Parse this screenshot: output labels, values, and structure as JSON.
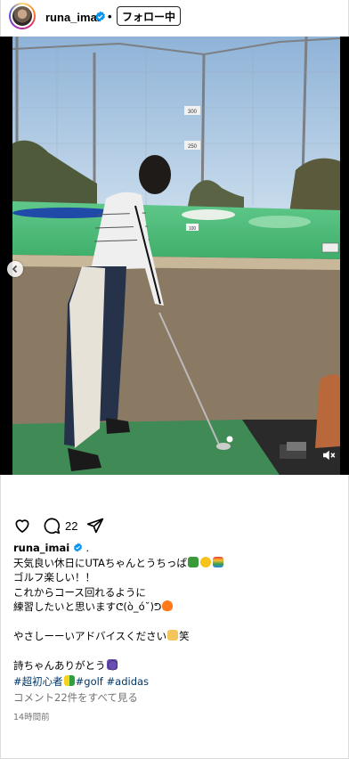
{
  "header": {
    "username": "runa_imai",
    "separator": "•",
    "follow_label": "フォロー中"
  },
  "media": {
    "range_sign_1": "300",
    "range_sign_2": "250",
    "ground_sign": "100"
  },
  "actions": {
    "comment_count": "22"
  },
  "caption": {
    "username": "runa_imai",
    "suffix": ".",
    "line1": "天気良い休日にUTAちゃんとうちっぱ",
    "line2": "ゴルフ楽しい！！",
    "line3": "これからコース回れるように",
    "line4": "練習したいと思いますᕦ(ò_ó˘)ᕤ",
    "line5": "やさしーーいアドバイスください",
    "line5_end": "笑",
    "line6": "詩ちゃんありがとう",
    "line6_end": "⃝"
  },
  "hashtags": {
    "tag1": "#超初心者",
    "tag2": "#golf",
    "tag3": "#adidas"
  },
  "comments_link": "コメント22件をすべて見る",
  "timestamp": "14時間前",
  "colors": {
    "verified": "#0095f6",
    "hashtag": "#00376b",
    "muted": "#737373"
  }
}
